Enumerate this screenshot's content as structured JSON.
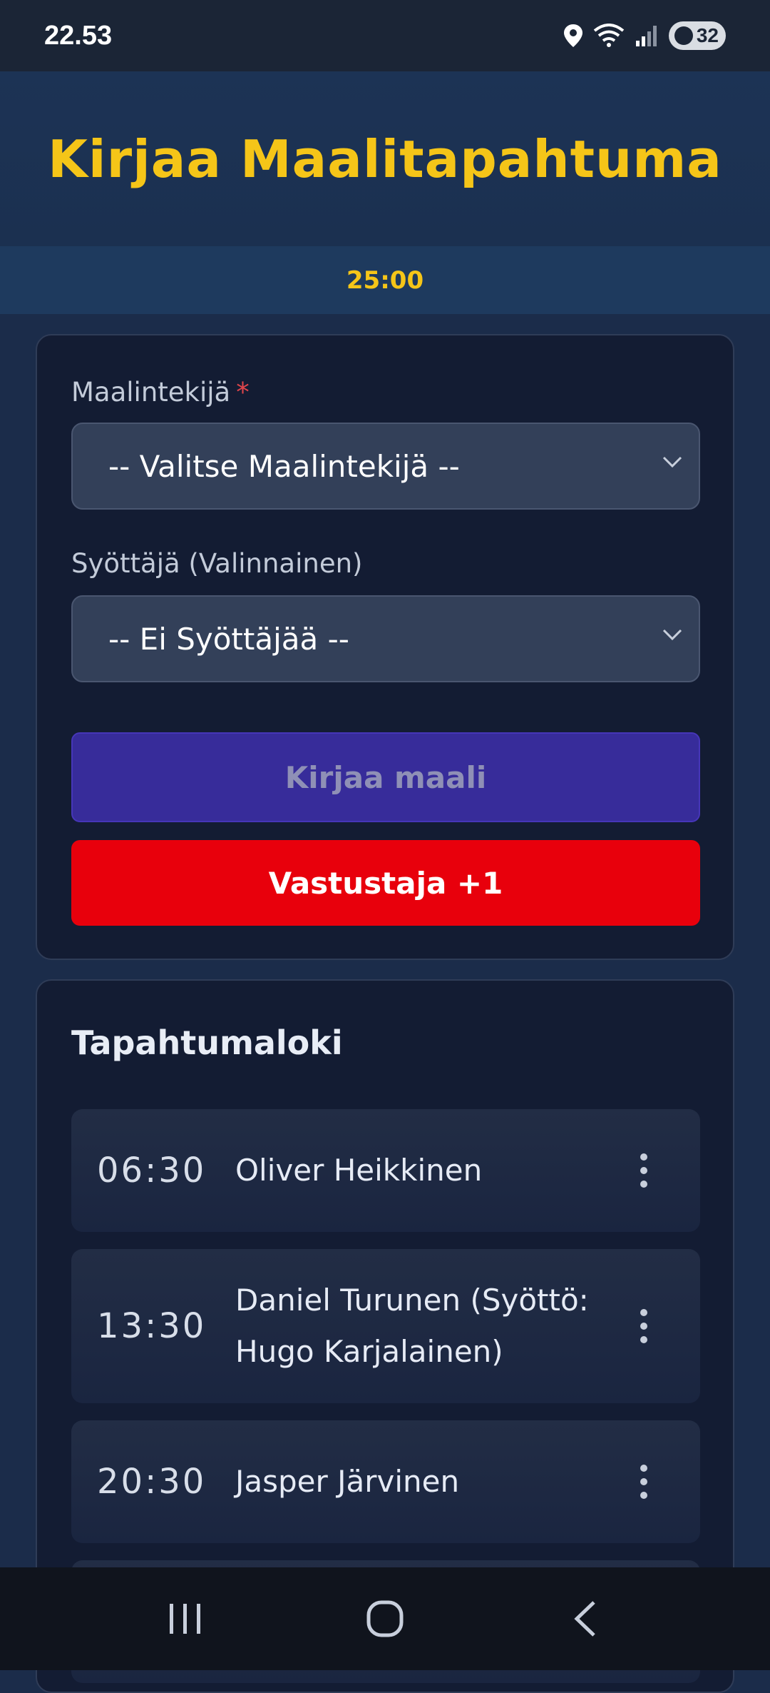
{
  "status_bar": {
    "time": "22.53",
    "battery": "32",
    "icons": [
      "location-icon",
      "wifi-icon",
      "signal-icon",
      "battery-icon"
    ]
  },
  "header": {
    "title": "Kirjaa Maalitapahtuma",
    "timer": "25:00"
  },
  "form": {
    "scorer_label": "Maalintekijä",
    "required_mark": "*",
    "scorer_value": "-- Valitse Maalintekijä --",
    "assist_label": "Syöttäjä (Valinnainen)",
    "assist_value": "-- Ei Syöttäjää --",
    "log_goal_label": "Kirjaa maali",
    "opponent_label": "Vastustaja +1"
  },
  "log": {
    "title": "Tapahtumaloki",
    "events": [
      {
        "time": "06:30",
        "text": "Oliver Heikkinen"
      },
      {
        "time": "13:30",
        "text": "Daniel Turunen (Syöttö: Hugo Karjalainen)"
      },
      {
        "time": "20:30",
        "text": "Jasper Järvinen"
      }
    ]
  },
  "nav": {
    "icons": [
      "recent-apps-icon",
      "home-icon",
      "back-icon"
    ]
  },
  "colors": {
    "accent": "#f5c518",
    "log_button": "#372c9a",
    "opponent_button": "#e8000c",
    "card": "#131c33"
  }
}
